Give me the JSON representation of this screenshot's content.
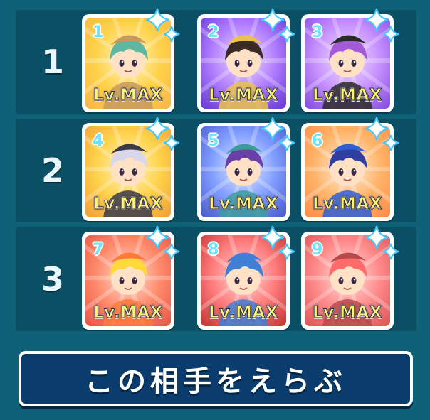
{
  "rows": [
    {
      "label": "1",
      "cards": [
        {
          "number": "1",
          "level": "Lv.MAX",
          "art_colors": [
            "#fff6c8",
            "#ffd24a",
            "#f8b84a"
          ],
          "hair": "#5fb7a2",
          "skin": "#ffe1c6",
          "hat": "#c69a5e"
        },
        {
          "number": "2",
          "level": "Lv.MAX",
          "art_colors": [
            "#efe0ff",
            "#b07cff",
            "#6a3fd6"
          ],
          "hair": "#3a2a24",
          "skin": "#ffe1c6",
          "hat": "#e9c24a"
        },
        {
          "number": "3",
          "level": "Lv.MAX",
          "art_colors": [
            "#f2e4ff",
            "#c690ff",
            "#8a52e0"
          ],
          "hair": "#a35ad6",
          "skin": "#ffe1c6",
          "hat": "#2a2a2a"
        }
      ]
    },
    {
      "label": "2",
      "cards": [
        {
          "number": "4",
          "level": "Lv.MAX",
          "art_colors": [
            "#fff3c0",
            "#ffd24a",
            "#f0a43a"
          ],
          "hair": "#d8d8ea",
          "skin": "#ffe1c6",
          "hat": "#3a3a4a"
        },
        {
          "number": "5",
          "level": "Lv.MAX",
          "art_colors": [
            "#e6ecff",
            "#7f9dff",
            "#4f5fd0"
          ],
          "hair": "#6a3fa8",
          "skin": "#ffe1c6",
          "hat": "#3c9c9c"
        },
        {
          "number": "6",
          "level": "Lv.MAX",
          "art_colors": [
            "#fff0e6",
            "#ffb56a",
            "#ff8f4a"
          ],
          "hair": "#2f3f9f",
          "skin": "#ffe1c6",
          "hat": "#2f5fd6"
        }
      ]
    },
    {
      "label": "3",
      "cards": [
        {
          "number": "7",
          "level": "Lv.MAX",
          "art_colors": [
            "#ffe0d8",
            "#ff8a6a",
            "#e85a4a"
          ],
          "hair": "#ffd83a",
          "skin": "#ffe1c6",
          "hat": "#ff7a3a"
        },
        {
          "number": "8",
          "level": "Lv.MAX",
          "art_colors": [
            "#ffd8d8",
            "#ff7a7a",
            "#c83a3a"
          ],
          "hair": "#3f7fd6",
          "skin": "#ffe1c6",
          "hat": "#3f7fd6"
        },
        {
          "number": "9",
          "level": "Lv.MAX",
          "art_colors": [
            "#ffe0e0",
            "#ff8a8a",
            "#e05a5a"
          ],
          "hair": "#ff6a6a",
          "skin": "#ffe1c6",
          "hat": "#b84a4a"
        }
      ]
    }
  ],
  "select_button": {
    "label": "この相手をえらぶ"
  },
  "colors": {
    "background": "#0f6178",
    "row_bg": "#0b4f64",
    "button_bg": "#0a3d6d",
    "number_color": "#66e6ff",
    "level_color": "#fff27a",
    "sparkle": "#ffffff"
  }
}
